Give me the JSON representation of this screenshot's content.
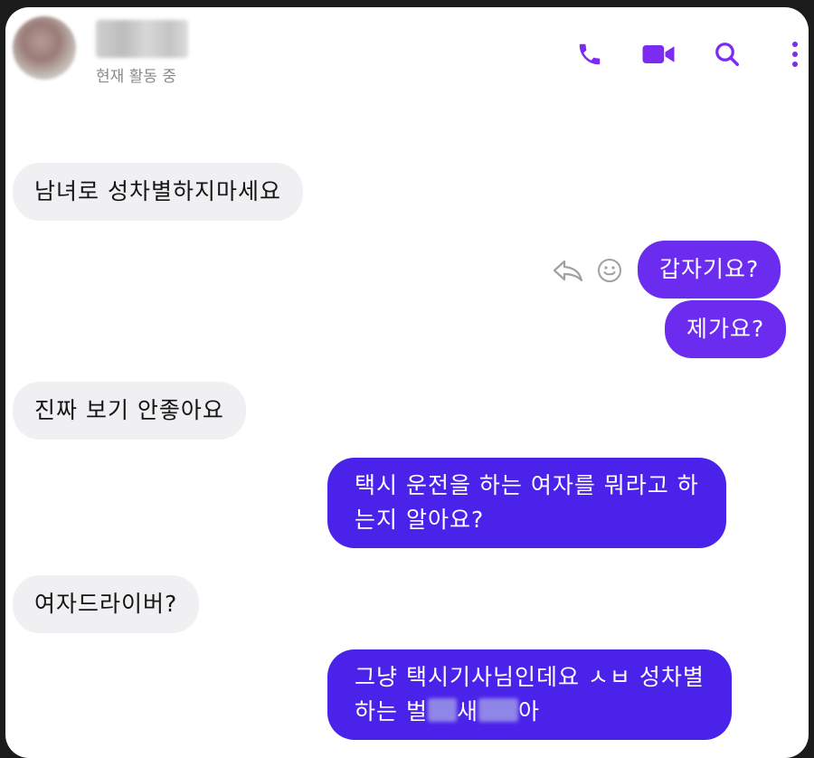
{
  "header": {
    "status": "현재 활동 중",
    "icons": [
      "phone-icon",
      "video-icon",
      "search-icon",
      "more-icon"
    ],
    "accent": "#7b2cf0"
  },
  "messages": [
    {
      "side": "in",
      "text": "남녀로 성차별하지마세요"
    },
    {
      "side": "out",
      "text": "갑자기요?"
    },
    {
      "side": "out",
      "text": "제가요?"
    },
    {
      "side": "in",
      "text": "진짜 보기 안좋아요"
    },
    {
      "side": "out",
      "line1": "택시 운전을 하는 여자를 뭐라고 하",
      "line2": "는지 알아요?"
    },
    {
      "side": "in",
      "text": "여자드라이버?"
    },
    {
      "side": "out",
      "line1": "그냥 택시기사님인데요 ㅅㅂ 성차별",
      "line2_a": "하는 벌",
      "line2_b": "새",
      "line2_c": "아"
    }
  ],
  "colors": {
    "incoming_bg": "#f0f0f2",
    "outgoing_bg": "#6b2cf0",
    "outgoing_bg_alt": "#4b22ea"
  }
}
